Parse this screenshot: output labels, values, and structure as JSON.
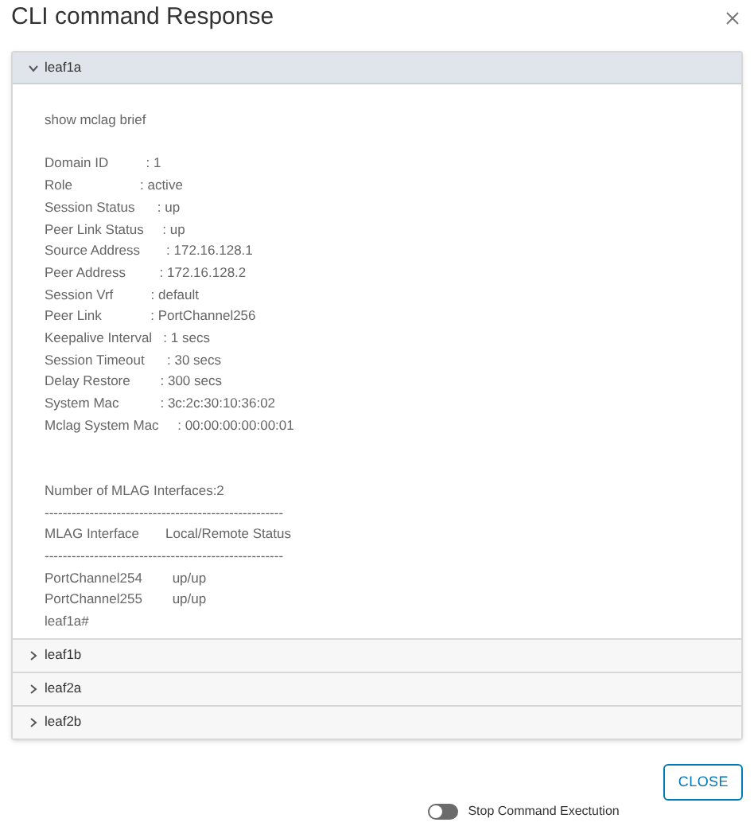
{
  "dialog": {
    "title": "CLI command Response"
  },
  "devices": [
    {
      "name": "leaf1a",
      "expanded": true,
      "output_blocks": [
        [
          "show mclag brief"
        ],
        [
          "Domain ID          : 1",
          "Role                  : active",
          "Session Status      : up",
          "Peer Link Status     : up",
          "Source Address       : 172.16.128.1",
          "Peer Address         : 172.16.128.2",
          "Session Vrf          : default",
          "Peer Link             : PortChannel256",
          "Keepalive Interval   : 1 secs",
          "Session Timeout      : 30 secs",
          "Delay Restore        : 300 secs",
          "System Mac           : 3c:2c:30:10:36:02",
          "Mclag System Mac     : 00:00:00:00:00:01"
        ],
        [
          "Number of MLAG Interfaces:2",
          "-----------------------------------------------------",
          "MLAG Interface       Local/Remote Status",
          "-----------------------------------------------------",
          "PortChannel254        up/up",
          "PortChannel255        up/up",
          "leaf1a#"
        ]
      ]
    },
    {
      "name": "leaf1b",
      "expanded": false
    },
    {
      "name": "leaf2a",
      "expanded": false
    },
    {
      "name": "leaf2b",
      "expanded": false
    }
  ],
  "footer": {
    "toggle": {
      "label": "Stop Command Exectution",
      "on": false
    },
    "close_button": "CLOSE"
  }
}
